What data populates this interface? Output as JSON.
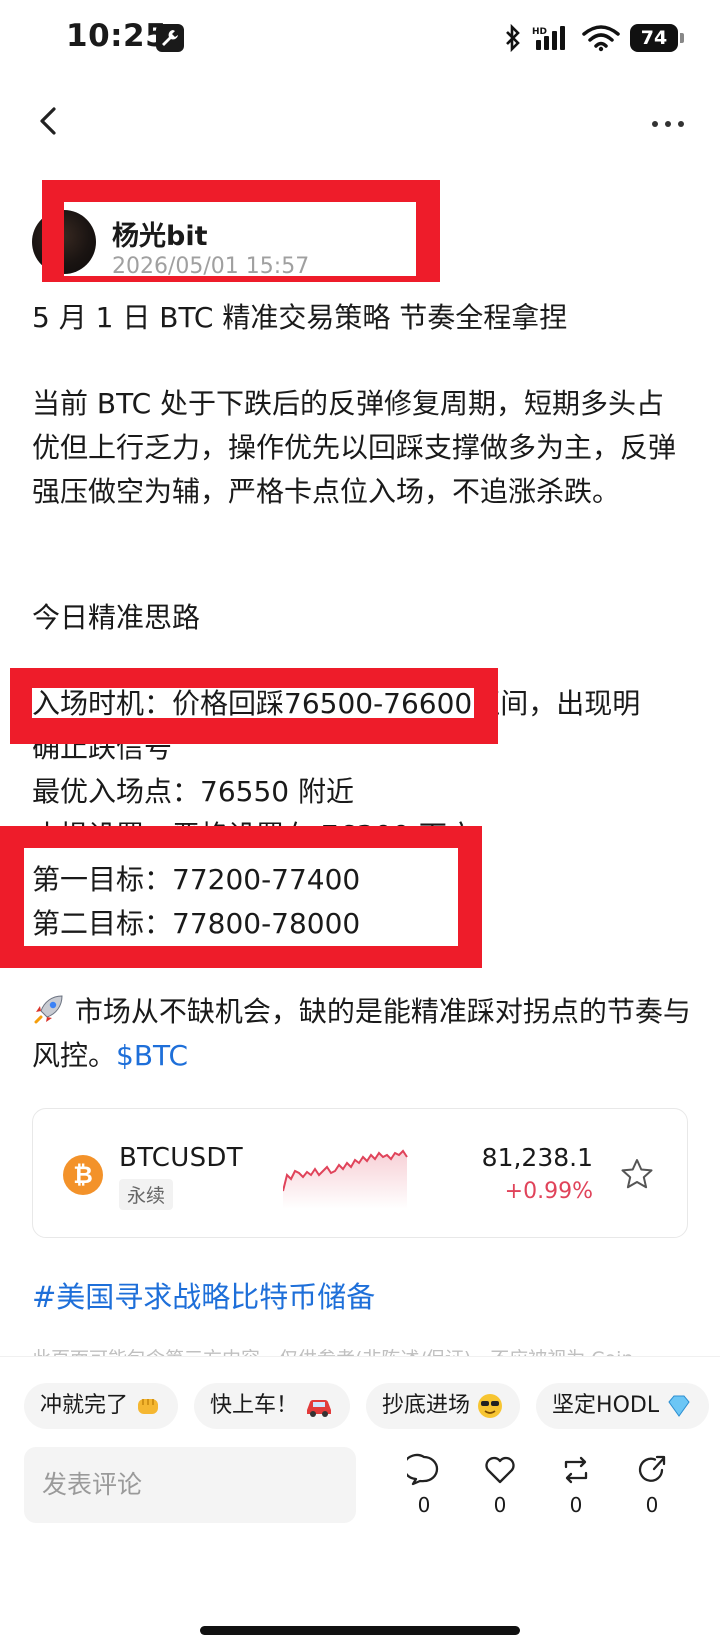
{
  "status_bar": {
    "time": "10:25",
    "battery": "74",
    "icons": [
      "wrench-icon",
      "bluetooth-icon",
      "signal-icon",
      "wifi-icon",
      "battery-icon"
    ]
  },
  "nav": {
    "back_icon": "chevron-left-icon",
    "more_icon": "more-horizontal-icon"
  },
  "author": {
    "name": "杨光bit",
    "timestamp": "2026/05/01 15:57"
  },
  "post": {
    "title": "5 月 1 日 BTC 精准交易策略 节奏全程拿捏",
    "intro": "当前 BTC 处于下跌后的反弹修复周期，短期多头占优但上行乏力，操作优先以回踩支撑做多为主，反弹强压做空为辅，严格卡点位入场，不追涨杀跌。",
    "section_heading": "今日精准思路",
    "entry_line_1": "入场时机：价格回踩76500-76600区间，出现明",
    "entry_line_2": "确止跌信号",
    "best_entry": "最优入场点：76550 附近",
    "stop_loss_partial": "止损设置：严格设置在 76300 下方",
    "target_1": "第一目标：77200-77400",
    "target_2": "第二目标：77800-78000",
    "closing": "市场从不缺机会，缺的是能精准踩对拐点的节奏与风控。",
    "closing_emoji": "rocket-icon",
    "cashtag": "$BTC",
    "hashtag": "#美国寻求战略比特币储备",
    "disclaimer": "此页面可能包含第三方内容，仅供参考(非陈述/保证)，不应被视为 Coin"
  },
  "ticker": {
    "symbol": "BTCUSDT",
    "type": "永续",
    "price": "81,238.1",
    "change": "+0.99%",
    "coin_glyph": "₿",
    "colors": {
      "up": "#e0435a",
      "coin": "#f3922a"
    }
  },
  "quick_replies": [
    {
      "label": "冲就完了",
      "icon": "fist-bump-icon"
    },
    {
      "label": "快上车！",
      "icon": "car-icon"
    },
    {
      "label": "抄底进场",
      "icon": "sunglasses-face-icon"
    },
    {
      "label": "坚定HODL",
      "icon": "gem-icon"
    }
  ],
  "comment_box": {
    "placeholder": "发表评论"
  },
  "actions": {
    "comment_count": "0",
    "like_count": "0",
    "repost_count": "0",
    "share_count": "0"
  },
  "colors": {
    "highlight_red": "#ee1c2a",
    "link_blue": "#1e6fd9"
  }
}
